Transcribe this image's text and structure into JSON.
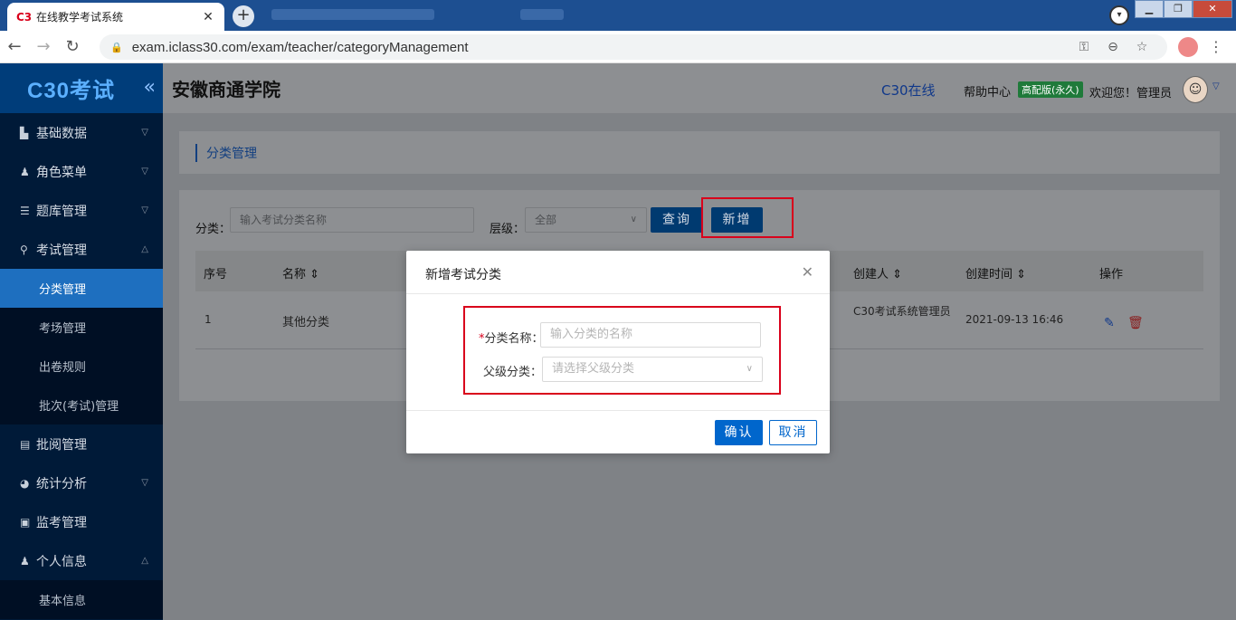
{
  "browser": {
    "tab_favicon": "C3",
    "tab_title": "在线教学考试系统",
    "tab_close": "✕",
    "new_tab": "+",
    "url": "exam.iclass30.com/exam/teacher/categoryManagement",
    "window_buttons": [
      "▁",
      "❐",
      "✕"
    ]
  },
  "sidebar": {
    "logo": "C30考试",
    "collapse_icon": "«",
    "items": [
      {
        "label": "基础数据",
        "icon": "chart-icon",
        "expanded": false
      },
      {
        "label": "角色菜单",
        "icon": "user-icon",
        "expanded": false
      },
      {
        "label": "题库管理",
        "icon": "list-icon",
        "expanded": false
      },
      {
        "label": "考试管理",
        "icon": "pin-icon",
        "expanded": true
      },
      {
        "label": "批阅管理",
        "icon": "doc-icon",
        "expanded": false
      },
      {
        "label": "统计分析",
        "icon": "pie-icon",
        "expanded": false
      },
      {
        "label": "监考管理",
        "icon": "monitor-icon",
        "expanded": false
      },
      {
        "label": "个人信息",
        "icon": "person-icon",
        "expanded": true
      }
    ],
    "exam_sub": [
      "分类管理",
      "考场管理",
      "出卷规则",
      "批次(考试)管理"
    ],
    "personal_sub": [
      "基本信息"
    ]
  },
  "header": {
    "school": "安徽商通学院",
    "link": "C30在线",
    "help": "帮助中心",
    "badge": "高配版(永久)",
    "welcome": "欢迎您！管理员"
  },
  "breadcrumb": "分类管理",
  "filter": {
    "category_label": "分类：",
    "category_placeholder": "输入考试分类名称",
    "level_label": "层级：",
    "level_value": "全部",
    "query_button": "查询",
    "add_button": "新增"
  },
  "table": {
    "headers": [
      "序号",
      "名称",
      "创建人",
      "创建时间",
      "操作"
    ],
    "rows": [
      {
        "index": "1",
        "name": "其他分类",
        "creator": "C30考试系统管理员",
        "created": "2021-09-13 16:46"
      }
    ]
  },
  "modal": {
    "title": "新增考试分类",
    "name_label": "分类名称：",
    "name_required": "*",
    "name_placeholder": "输入分类的名称",
    "parent_label": "父级分类：",
    "parent_placeholder": "请选择父级分类",
    "ok_button": "确认",
    "cancel_button": "取消"
  }
}
